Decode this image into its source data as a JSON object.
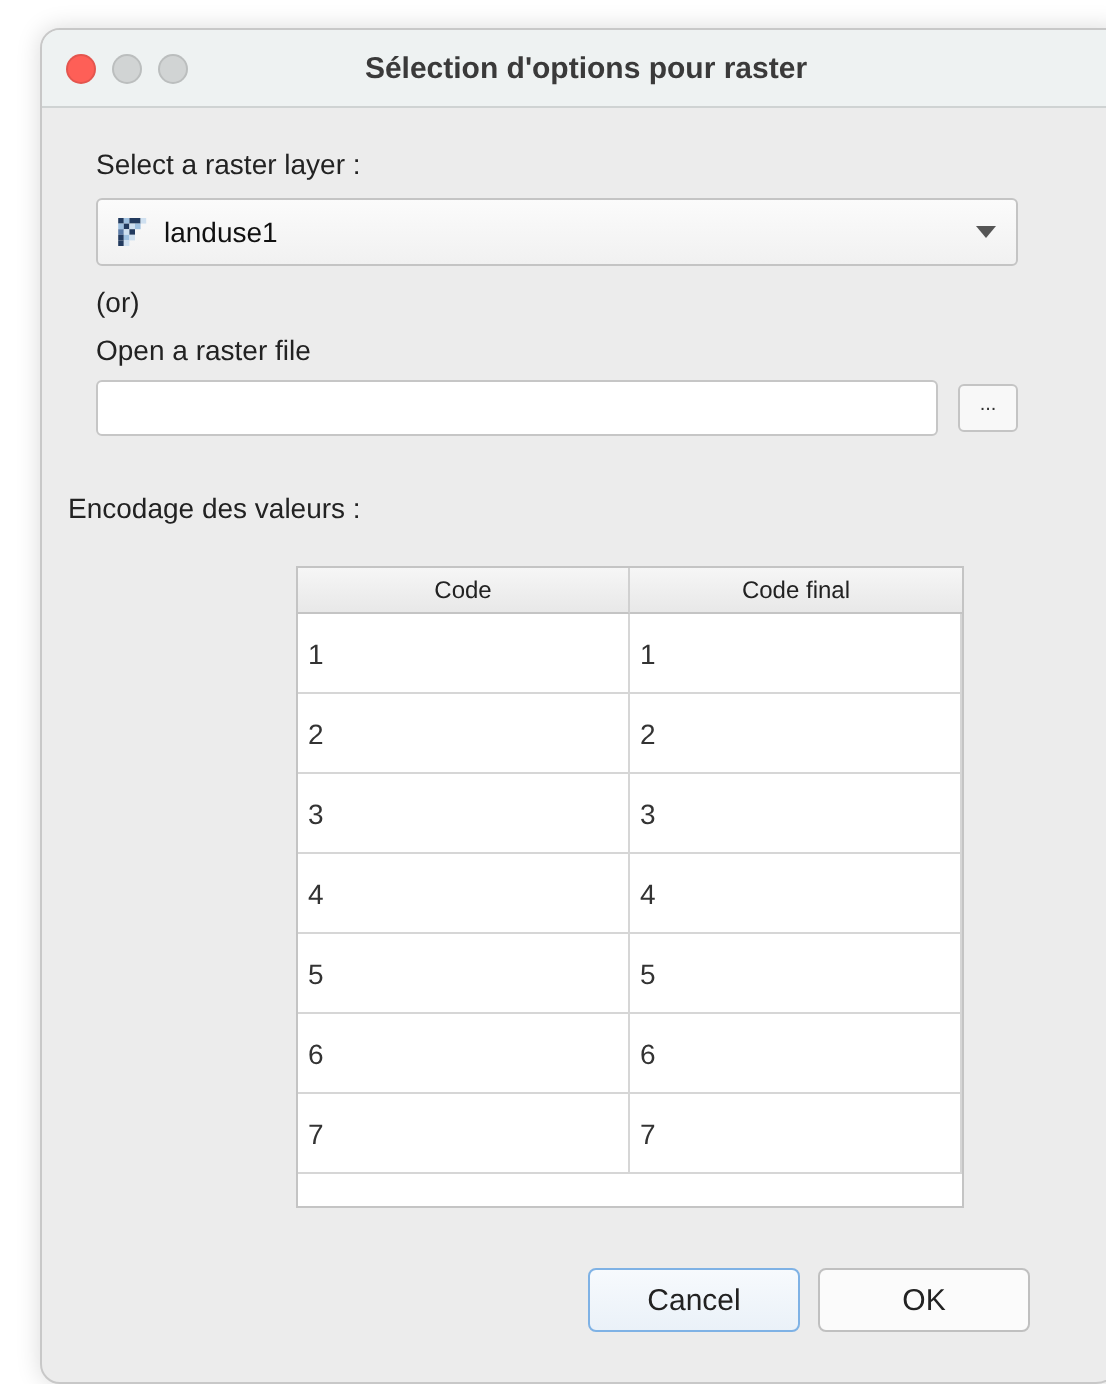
{
  "window": {
    "title": "Sélection d'options pour raster"
  },
  "layer_label": "Select a raster layer :",
  "layer_select": {
    "value": "landuse1"
  },
  "or_label": "(or)",
  "file_label": "Open a raster file",
  "file_browse": "...",
  "encoding_label": "Encodage des valeurs :",
  "table": {
    "columns": [
      "Code",
      "Code final"
    ],
    "rows": [
      [
        "1",
        "1"
      ],
      [
        "2",
        "2"
      ],
      [
        "3",
        "3"
      ],
      [
        "4",
        "4"
      ],
      [
        "5",
        "5"
      ],
      [
        "6",
        "6"
      ],
      [
        "7",
        "7"
      ]
    ]
  },
  "buttons": [
    {
      "label": "Cancel",
      "focused": true
    },
    {
      "label": "OK",
      "focused": false
    }
  ]
}
